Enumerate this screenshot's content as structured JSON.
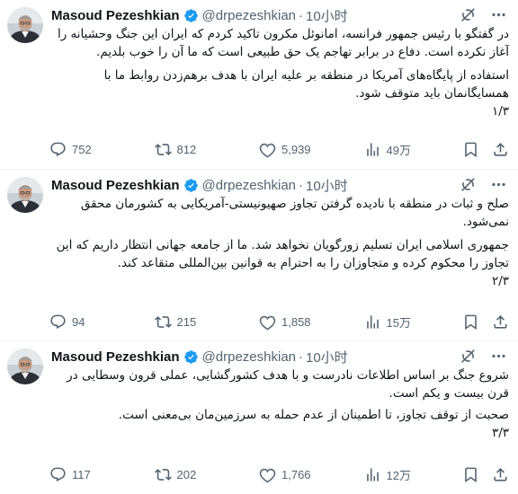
{
  "tweets": [
    {
      "author_name": "Masoud Pezeshkian",
      "handle": "@drpezeshkian",
      "separator": "·",
      "time": "10小时",
      "lines": [
        "در گفتگو با رئیس جمهور فرانسه، امانوئل مکرون تاکید کردم که ایران این جنگ وحشیانه را آغاز نکرده است. دفاع در برابر تهاجم یک حق طبیعی است که ما آن را خوب بلدیم.",
        "استفاده از پایگاه‌های آمریکا در منطقه بر علیه ایران با هدف برهم‌زدن روابط ما با همسایگانمان باید متوقف شود.",
        "۱/۳"
      ],
      "replies": "752",
      "reposts": "812",
      "likes": "5,939",
      "views": "49万"
    },
    {
      "author_name": "Masoud Pezeshkian",
      "handle": "@drpezeshkian",
      "separator": "·",
      "time": "10小时",
      "lines": [
        "صلح و ثبات در منطقه با نادیده گرفتن تجاوز صهیونیستی-آمریکایی به کشورمان محقق نمی‌شود.",
        "جمهوری اسلامی ایران تسلیم زورگویان نخواهد شد. ما از جامعه جهانی انتظار داریم که این تجاوز را محکوم کرده و متجاوزان را به احترام به قوانین بین‌المللی متقاعد کند.",
        "۲/۳"
      ],
      "replies": "94",
      "reposts": "215",
      "likes": "1,858",
      "views": "15万"
    },
    {
      "author_name": "Masoud Pezeshkian",
      "handle": "@drpezeshkian",
      "separator": "·",
      "time": "10小时",
      "lines": [
        "شروع جنگ بر اساس اطلاعات نادرست و با هدف کشورگشایی، عملی قرون وسطایی در قرن بیست و یکم است.",
        "صحبت از توقف تجاوز، تا اطمینان از عدم حمله به سرزمین‌مان بی‌معنی است.",
        "۳/۳"
      ],
      "replies": "117",
      "reposts": "202",
      "likes": "1,766",
      "views": "12万"
    }
  ],
  "colors": {
    "text": "#0f1419",
    "muted": "#536471",
    "verified": "#1d9bf0",
    "divider": "#eff3f4"
  },
  "icons": [
    "grok-icon",
    "more-icon",
    "verified-badge-icon",
    "reply-icon",
    "repost-icon",
    "like-icon",
    "views-icon",
    "bookmark-icon",
    "share-icon"
  ]
}
